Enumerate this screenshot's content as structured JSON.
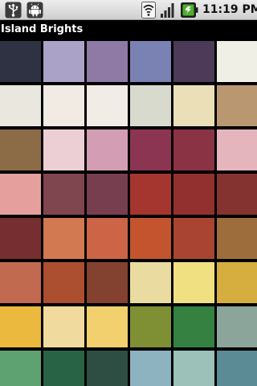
{
  "status_bar": {
    "time": "11:19 PM",
    "icons": [
      "usb-icon",
      "android-icon",
      "wifi-icon",
      "signal-icon",
      "battery-icon"
    ],
    "text_color": "#111111",
    "battery_color": "#4caf2e"
  },
  "title_bar": {
    "title": "Island Brights"
  },
  "palette": {
    "columns": 6,
    "rows": [
      [
        "#2e3243",
        "#aba2c8",
        "#8e7aa5",
        "#7a82b3",
        "#4c3a58",
        "#efefe6"
      ],
      [
        "#e9e7de",
        "#f2ebe4",
        "#f1ece6",
        "#d8dacd",
        "#ebdfb7",
        "#b99770"
      ],
      [
        "#8c6b47",
        "#eccfd5",
        "#d39eb4",
        "#8b3553",
        "#8a3345",
        "#e5b5bd"
      ],
      [
        "#e5a09e",
        "#804650",
        "#773e50",
        "#a5362f",
        "#92302f",
        "#853330"
      ],
      [
        "#772e31",
        "#d37952",
        "#cd6446",
        "#c3542d",
        "#a94433",
        "#9e6d3c"
      ],
      [
        "#c26a50",
        "#ab4f30",
        "#83412f",
        "#eadba0",
        "#f1e082",
        "#d5ae3f"
      ],
      [
        "#ebb93d",
        "#f0da9d",
        "#f2d06d",
        "#7f8f33",
        "#348141",
        "#8ca59a"
      ],
      [
        "#5fa272",
        "#286345",
        "#2f4e43",
        "#8db2c0",
        "#9cc1b8",
        "#5b8c95"
      ]
    ]
  }
}
